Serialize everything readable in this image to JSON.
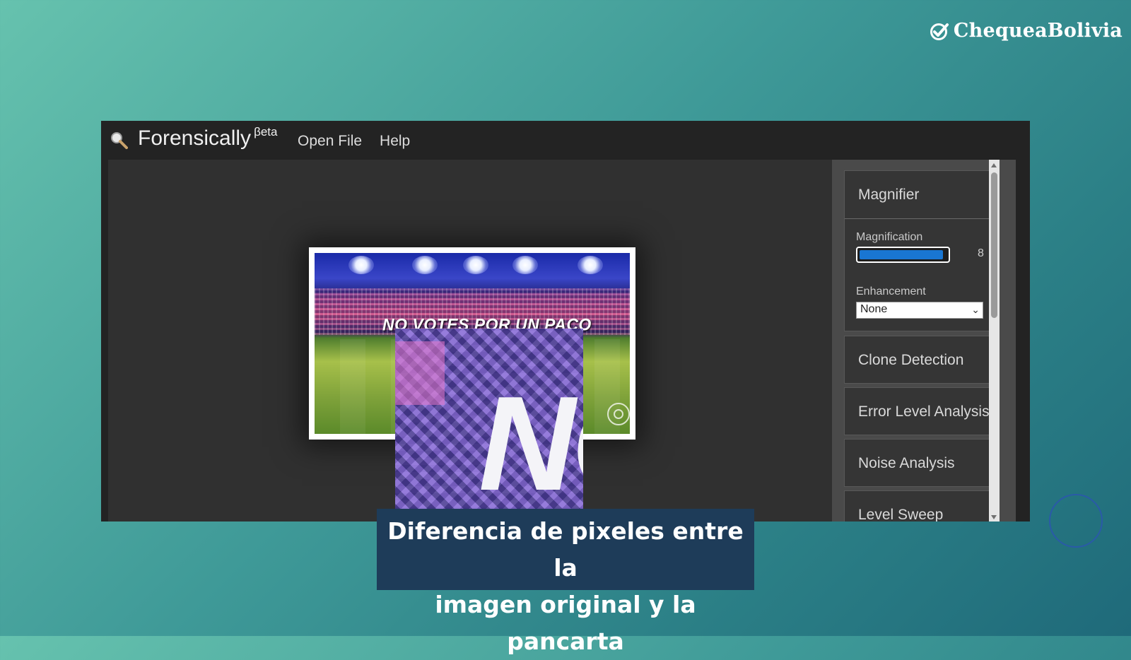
{
  "brand": {
    "name": "ChequeaBolivia",
    "icon": "check-circle-icon"
  },
  "app": {
    "title": "Forensically",
    "title_sup": "βeta",
    "menu": [
      "Open File",
      "Help"
    ],
    "app_icon": "magnifying-glass-icon"
  },
  "image": {
    "banner_text": "NO VOTES POR UN PACO",
    "magnified_letters": "NC"
  },
  "panel": {
    "magnifier": {
      "title": "Magnifier",
      "magnification_label": "Magnification",
      "magnification_value": "8",
      "magnification_fill_fraction": 0.96,
      "enhancement_label": "Enhancement",
      "enhancement_value": "None"
    },
    "tools": [
      "Clone Detection",
      "Error Level Analysis",
      "Noise Analysis",
      "Level Sweep"
    ]
  },
  "caption": {
    "line1": "Diferencia de pixeles entre la",
    "line2": "imagen original y la pancarta"
  },
  "colors": {
    "accent": "#1976d2",
    "caption_bg": "#1e3c59",
    "app_bg": "#232323"
  }
}
